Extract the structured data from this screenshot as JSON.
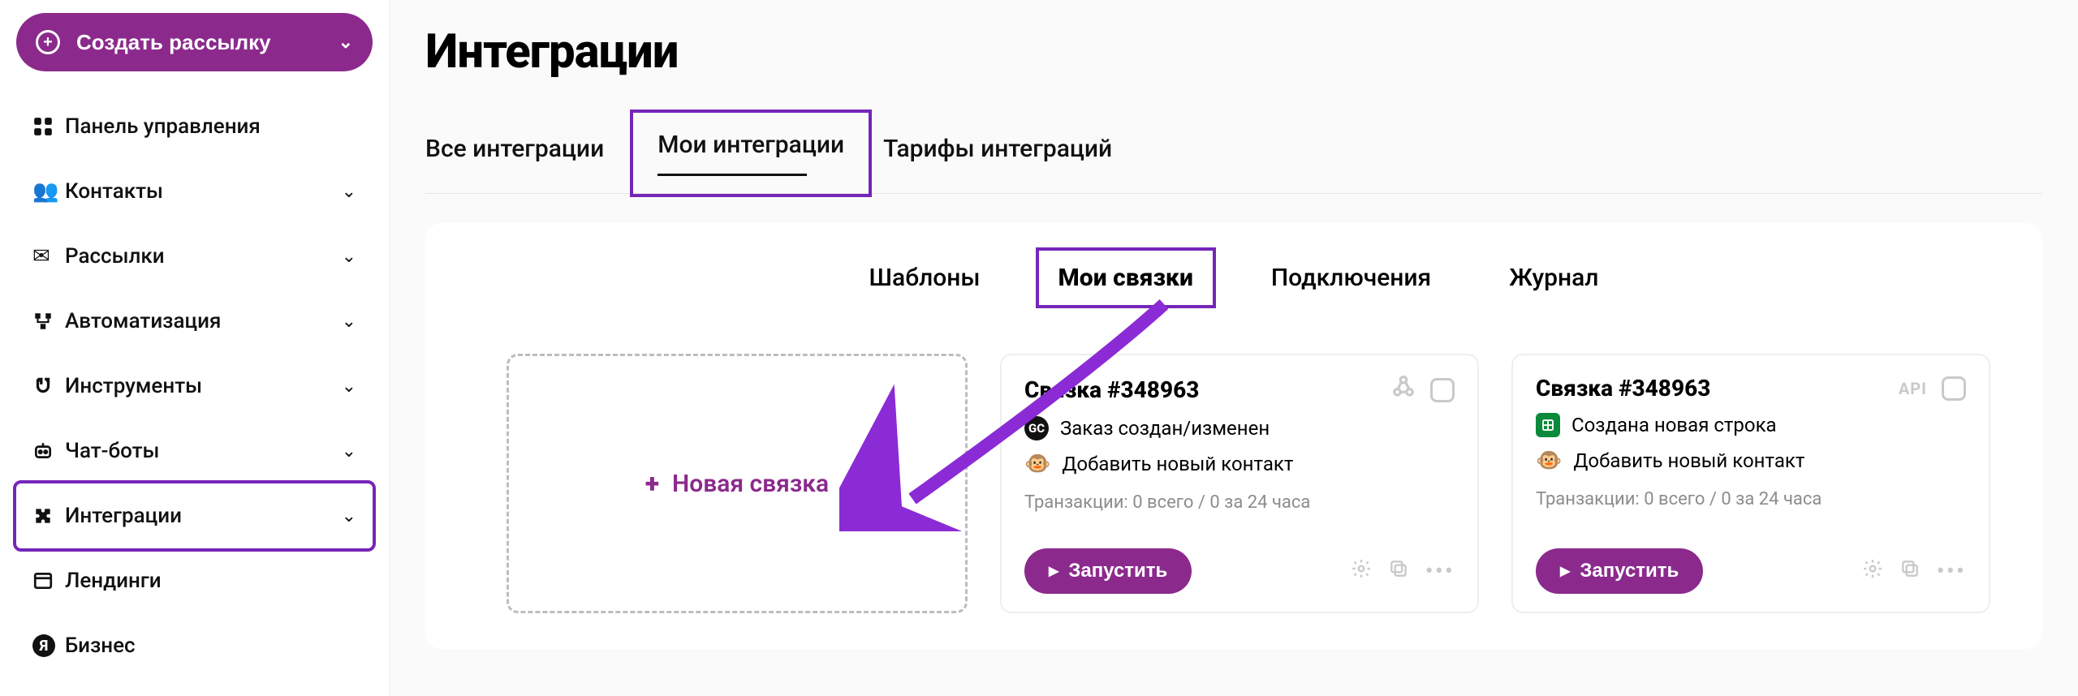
{
  "sidebar": {
    "create_label": "Создать рассылку",
    "items": [
      {
        "label": "Панель управления",
        "chev": false
      },
      {
        "label": "Контакты",
        "chev": true
      },
      {
        "label": "Рассылки",
        "chev": true
      },
      {
        "label": "Автоматизация",
        "chev": true
      },
      {
        "label": "Инструменты",
        "chev": true
      },
      {
        "label": "Чат-боты",
        "chev": true
      },
      {
        "label": "Интеграции",
        "chev": true
      },
      {
        "label": "Лендинги",
        "chev": false
      },
      {
        "label": "Бизнес",
        "chev": false
      }
    ]
  },
  "page_title": "Интеграции",
  "top_tabs": {
    "all": "Все интеграции",
    "my": "Мои интеграции",
    "tariffs": "Тарифы интеграций"
  },
  "sub_tabs": {
    "templates": "Шаблоны",
    "my_bundles": "Мои связки",
    "connections": "Подключения",
    "journal": "Журнал"
  },
  "new_card_label": "Новая связка",
  "cards": [
    {
      "title": "Связка #348963",
      "head_badge": "webhook-icon",
      "line1_icon": "GC",
      "line1_text": "Заказ создан/изменен",
      "line2_text": "Добавить новый контакт",
      "stats": "Транзакции: 0 всего / 0 за 24 часа",
      "run_label": "Запустить"
    },
    {
      "title": "Связка #348963",
      "head_badge": "api",
      "line1_icon": "sheets",
      "line1_text": "Создана новая строка",
      "line2_text": "Добавить новый контакт",
      "stats": "Транзакции: 0 всего / 0 за 24 часа",
      "run_label": "Запустить"
    }
  ],
  "api_text": "API"
}
